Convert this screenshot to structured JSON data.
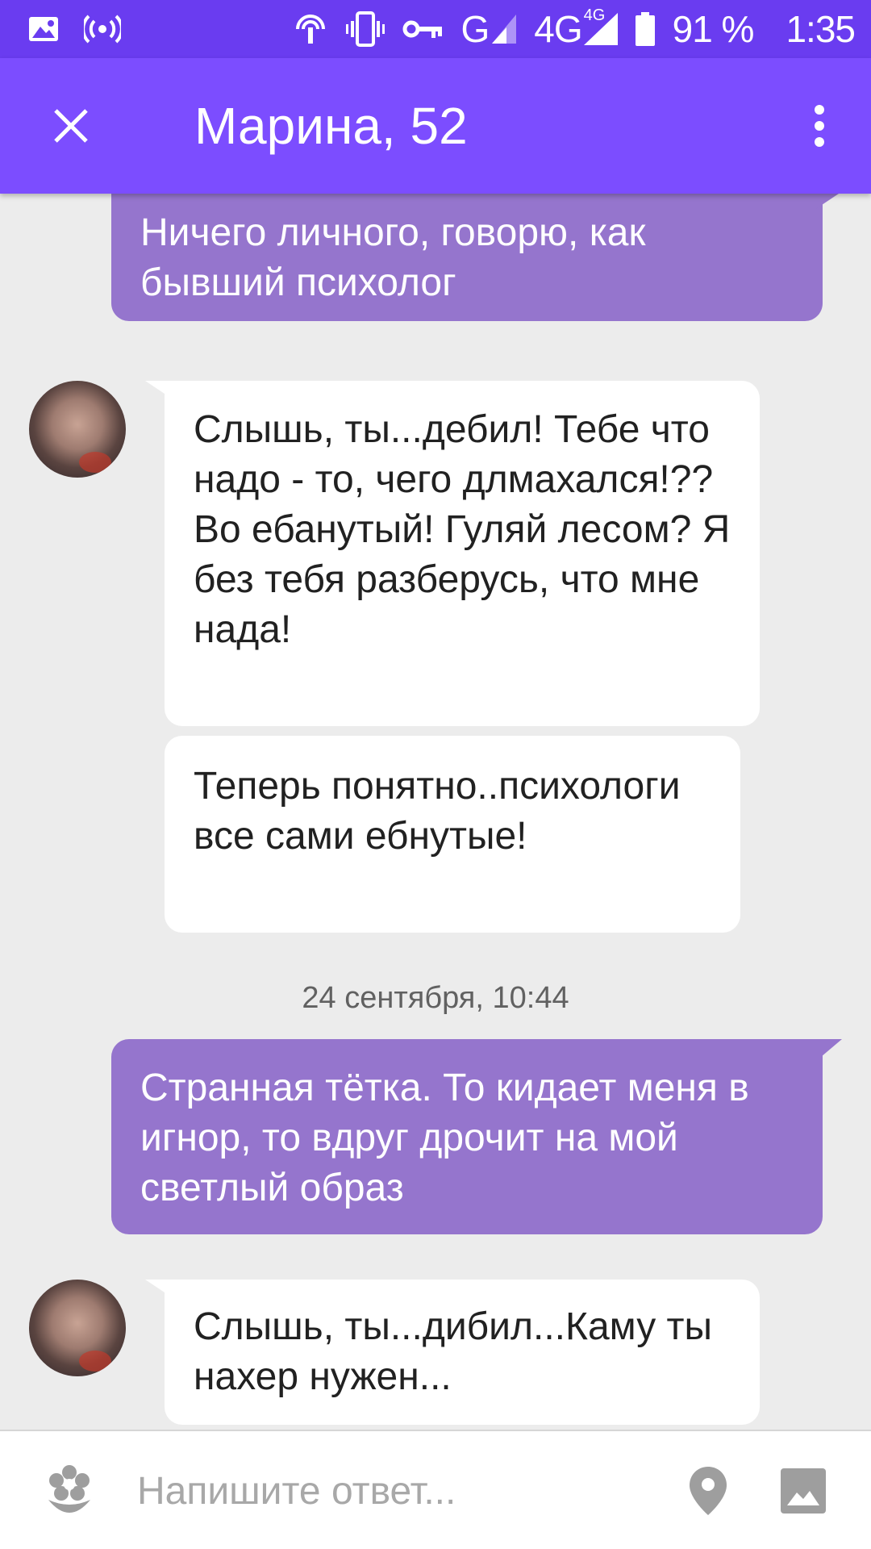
{
  "status_bar": {
    "network_type": "G",
    "network_type_2": "4G",
    "network_sup": "4G",
    "battery": "91 %",
    "time": "1:35",
    "icons": [
      "image-icon",
      "hotspot-icon",
      "wifi-calling-icon",
      "vibrate-icon",
      "vpn-key-icon",
      "signal-icon",
      "signal-4g-icon",
      "battery-icon"
    ]
  },
  "header": {
    "title": "Марина, 52",
    "close_icon": "close-icon",
    "menu_icon": "more-vertical-icon"
  },
  "messages": [
    {
      "direction": "out",
      "text": "Ничего личного, говорю, как бывший психолог"
    },
    {
      "direction": "in",
      "text": "Слышь, ты...дебил! Тебе что надо - то, чего длмахался!?? Во ебанутый! Гуляй лесом? Я без тебя разберусь, что мне нада!"
    },
    {
      "direction": "in",
      "text": "Теперь понятно..психологи все сами ебнутые!"
    },
    {
      "direction": "out",
      "text": "Странная тётка. То кидает меня в игнор, то вдруг дрочит на мой светлый образ"
    },
    {
      "direction": "in",
      "text": "Слышь, ты...дибил...Каму ты нахер нужен..."
    }
  ],
  "date_separator": "24 сентября, 10:44",
  "composer": {
    "placeholder": "Напишите ответ...",
    "value": "",
    "icons": [
      "sticker-icon",
      "location-pin-icon",
      "image-icon"
    ]
  },
  "colors": {
    "status_bar": "#6a3cf0",
    "app_bar": "#7c4dff",
    "outgoing_bubble": "#9575cd",
    "incoming_bubble": "#ffffff",
    "background": "#ececec"
  }
}
